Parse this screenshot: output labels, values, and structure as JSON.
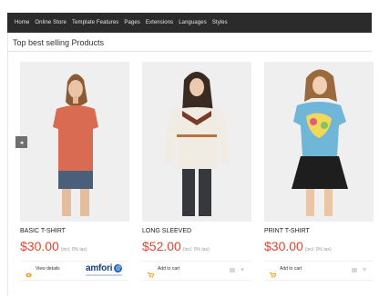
{
  "nav": {
    "items": [
      "Home",
      "Online Store",
      "Template Features",
      "Pages",
      "Extensions",
      "Languages",
      "Styles"
    ]
  },
  "section": {
    "title": "Top best selling Products"
  },
  "products": [
    {
      "name": "BASIC T-SHIRT",
      "price": "$30.00",
      "tax": "(incl. 0% tax)",
      "action_label": "View details",
      "action_icon": "eye-icon",
      "badge": {
        "logo_text": "amfori",
        "mark": "@"
      }
    },
    {
      "name": "LONG SLEEVED",
      "price": "$52.00",
      "tax": "(incl. 0% tax)",
      "action_label": "Add to cart",
      "action_icon": "cart-icon"
    },
    {
      "name": "PRINT T-SHIRT",
      "price": "$30.00",
      "tax": "(incl. 0% tax)",
      "action_label": "Add to cart",
      "action_icon": "cart-icon"
    }
  ],
  "slider": {
    "prev_icon": "chevron-left-icon",
    "prev_glyph": "◂"
  },
  "colors": {
    "nav_bg": "#2b2b2b",
    "price": "#e0452f",
    "action_icon": "#f2a329",
    "amfori_blue": "#173d7a"
  }
}
